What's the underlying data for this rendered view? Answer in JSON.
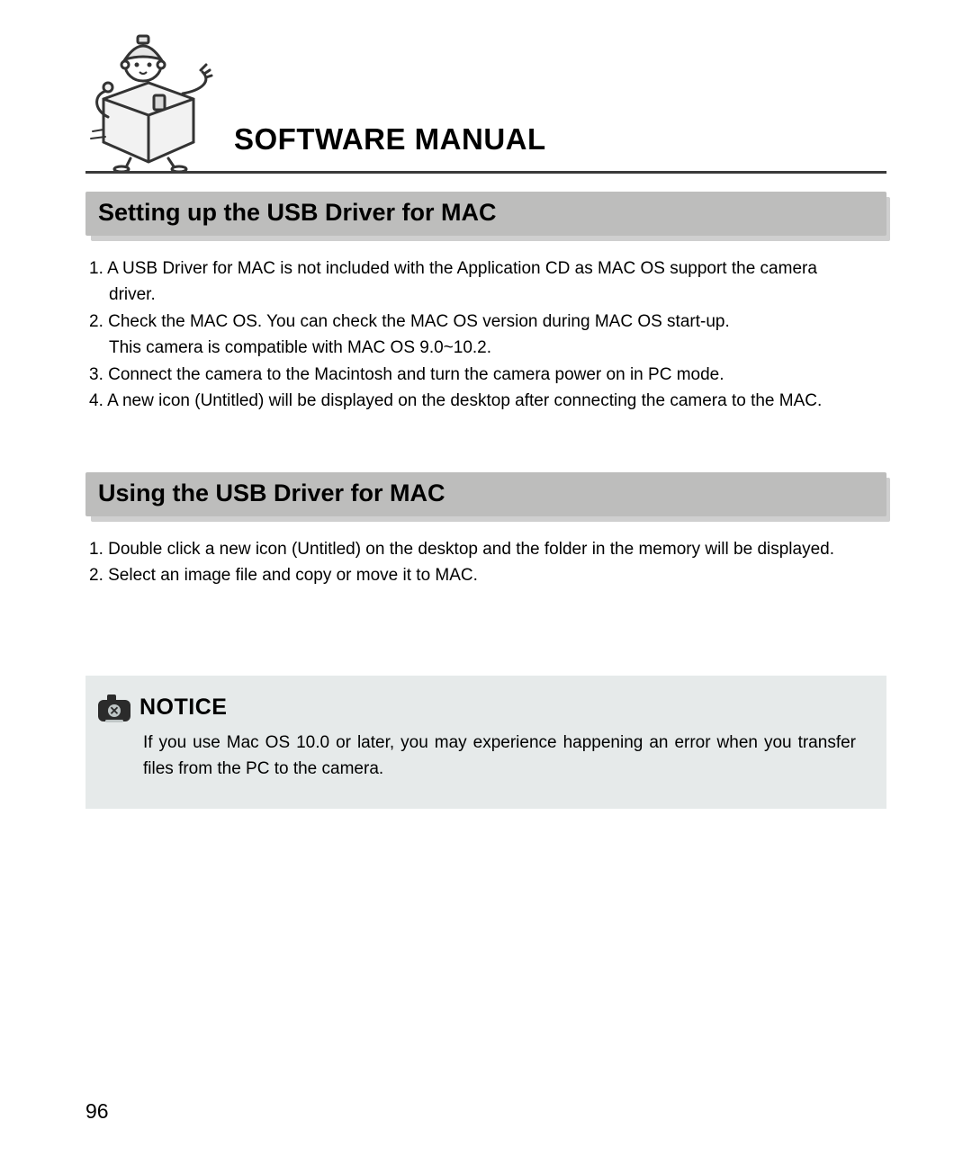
{
  "header": {
    "title": "SOFTWARE MANUAL"
  },
  "section1": {
    "heading": "Setting up the USB Driver for MAC",
    "lines": [
      "1. A USB Driver for MAC is not included with the Application CD as MAC OS support the camera",
      "driver.",
      "2. Check the MAC OS. You can check the MAC OS version during MAC OS start-up.",
      "This camera is compatible with MAC OS 9.0~10.2.",
      "3. Connect the camera to the Macintosh and turn the camera power on in PC mode.",
      "4. A new icon (Untitled) will be displayed on the desktop after connecting the camera to the MAC."
    ]
  },
  "section2": {
    "heading": "Using the USB Driver for MAC",
    "lines": [
      "1. Double click a new icon (Untitled) on the desktop and the folder in the memory will be displayed.",
      "2. Select an image file and copy or move it to MAC."
    ]
  },
  "notice": {
    "title": "NOTICE",
    "body": "If you use Mac OS 10.0 or later, you may experience happening an error when you transfer files from the PC to the camera."
  },
  "page_number": "96"
}
